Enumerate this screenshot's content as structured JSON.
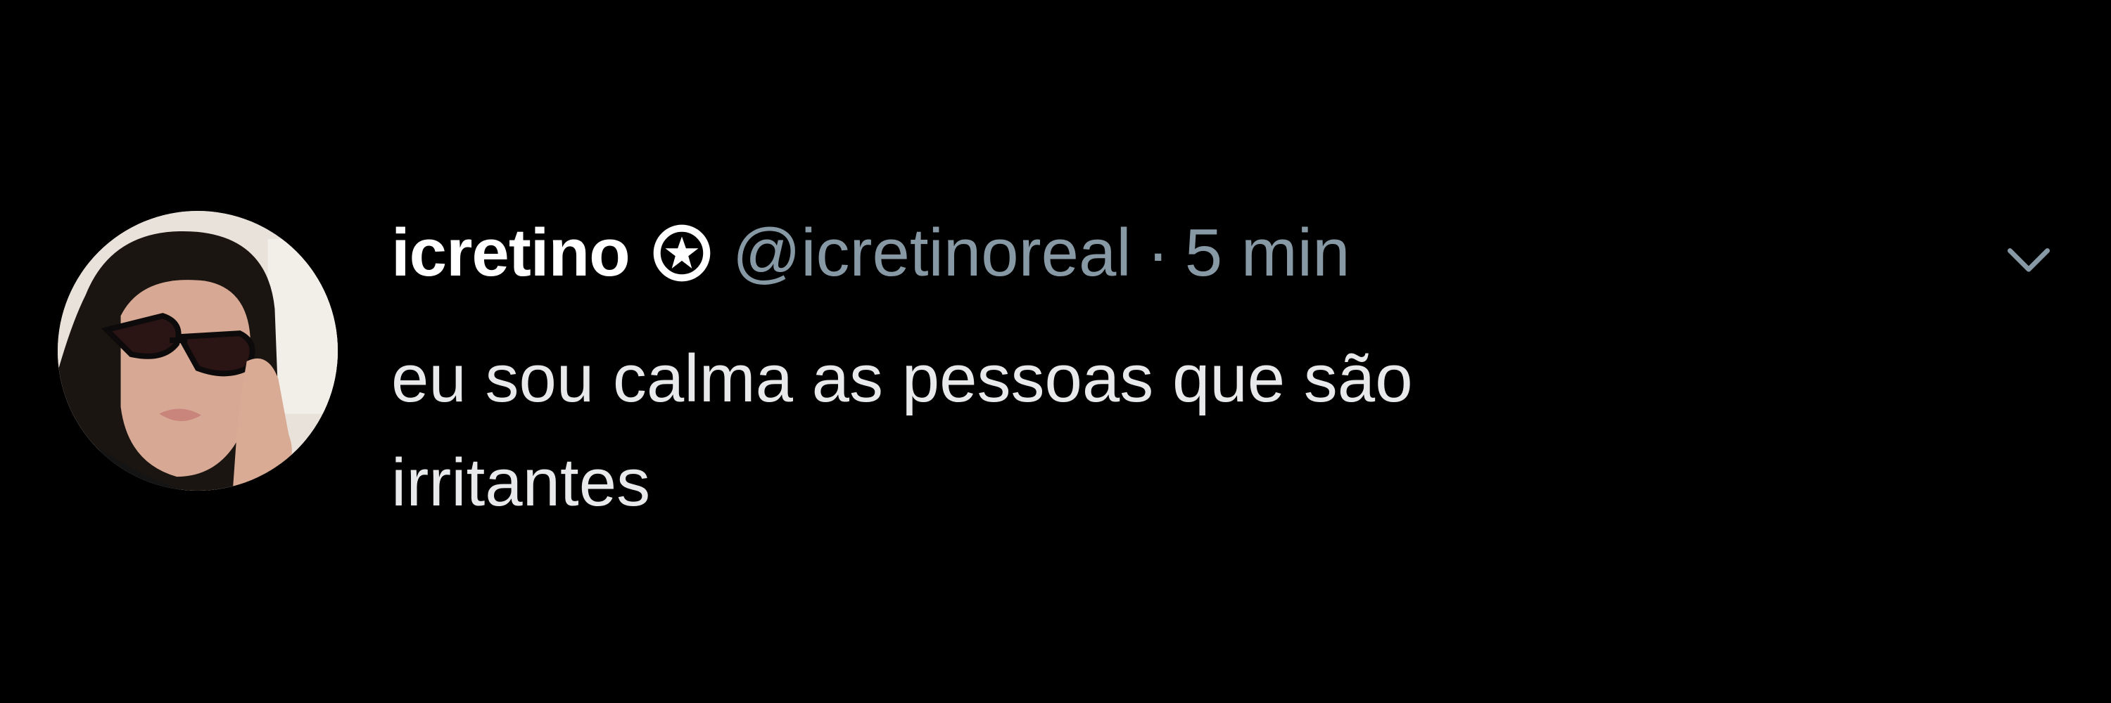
{
  "tweet": {
    "display_name": "icretino",
    "handle": "@icretinoreal",
    "separator": "·",
    "time": "5 min",
    "text_lines": [
      "eu sou calma as pessoas que são",
      "irritantes"
    ]
  },
  "icons": {
    "verified": "star-badge-icon",
    "menu": "chevron-down-icon"
  },
  "colors": {
    "background": "#000000",
    "name": "#ffffff",
    "secondary": "#8899a6",
    "body_text": "#e7e9ea"
  }
}
